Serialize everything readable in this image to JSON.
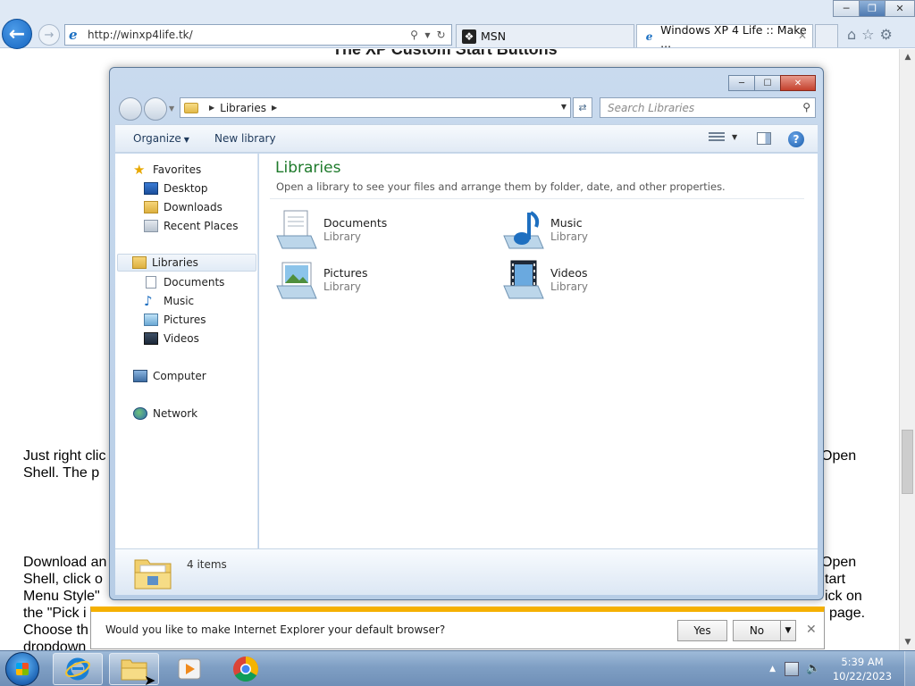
{
  "browser": {
    "address": "http://winxp4life.tk/",
    "tabs": [
      {
        "title": "MSN"
      },
      {
        "title": "Windows XP 4 Life :: Make ..."
      }
    ]
  },
  "webpage": {
    "heading": "The XP Custom Start Buttons",
    "para1": [
      "Just right clic",
      "Shell.  The p"
    ],
    "para1_right": "Open",
    "para2": [
      "Download an",
      "Shell, click o",
      "Menu Style\"",
      "the \"Pick i",
      "Choose th",
      "dropdown"
    ],
    "para2_right": [
      "Open",
      "tart",
      "ick on",
      "page."
    ]
  },
  "explorer": {
    "breadcrumb": "Libraries",
    "search_placeholder": "Search Libraries",
    "toolbar": {
      "organize": "Organize",
      "new_library": "New library"
    },
    "nav": {
      "favorites": "Favorites",
      "favorites_items": [
        "Desktop",
        "Downloads",
        "Recent Places"
      ],
      "libraries": "Libraries",
      "libraries_items": [
        "Documents",
        "Music",
        "Pictures",
        "Videos"
      ],
      "computer": "Computer",
      "network": "Network"
    },
    "content": {
      "title": "Libraries",
      "description": "Open a library to see your files and arrange them by folder, date, and other properties.",
      "items": [
        {
          "name": "Documents",
          "type": "Library"
        },
        {
          "name": "Music",
          "type": "Library"
        },
        {
          "name": "Pictures",
          "type": "Library"
        },
        {
          "name": "Videos",
          "type": "Library"
        }
      ]
    },
    "details": "4 items"
  },
  "notification": {
    "text": "Would you like to make Internet Explorer your default browser?",
    "yes": "Yes",
    "no": "No"
  },
  "taskbar": {
    "time": "5:39 AM",
    "date": "10/22/2023"
  },
  "colors": {
    "library_title": "#1e7a2b",
    "notification_accent": "#f5b000",
    "taskbar": "#7f9fc4"
  }
}
